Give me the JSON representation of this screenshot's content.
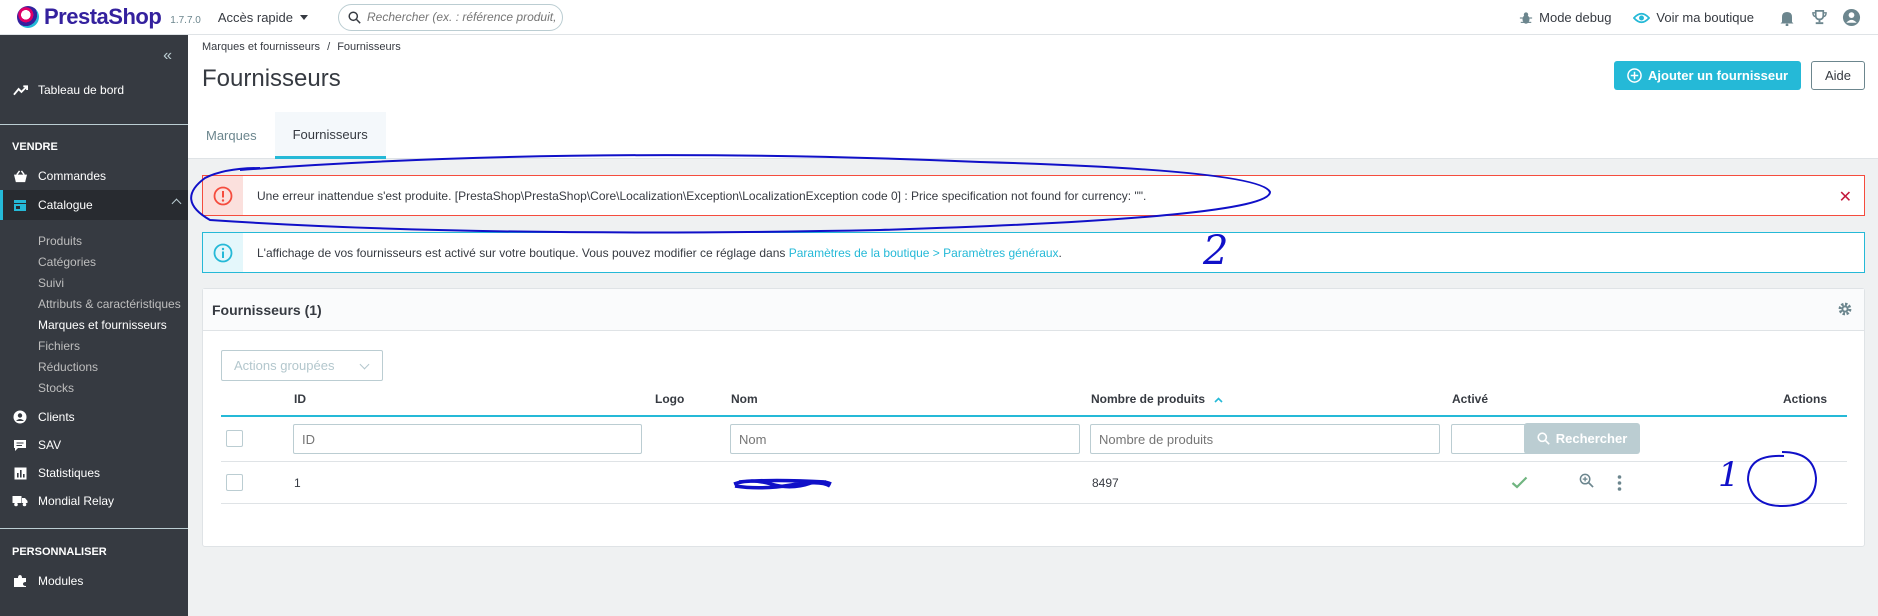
{
  "header": {
    "brand": "PrestaShop",
    "version": "1.7.7.0",
    "quick_access": "Accès rapide",
    "search_placeholder": "Rechercher (ex. : référence produit, nom",
    "debug_label": "Mode debug",
    "view_shop_label": "Voir ma boutique"
  },
  "sidebar": {
    "dashboard": "Tableau de bord",
    "section_sell": "VENDRE",
    "orders": "Commandes",
    "catalog": "Catalogue",
    "catalog_items": [
      "Produits",
      "Catégories",
      "Suivi",
      "Attributs & caractéristiques",
      "Marques et fournisseurs",
      "Fichiers",
      "Réductions",
      "Stocks"
    ],
    "customers": "Clients",
    "sav": "SAV",
    "stats": "Statistiques",
    "mondial": "Mondial Relay",
    "section_custom": "PERSONNALISER",
    "modules": "Modules"
  },
  "page": {
    "breadcrumb_parent": "Marques et fournisseurs",
    "breadcrumb_sep": "/",
    "breadcrumb_current": "Fournisseurs",
    "title": "Fournisseurs",
    "add_button": "Ajouter un fournisseur",
    "help_button": "Aide",
    "tabs": [
      "Marques",
      "Fournisseurs"
    ]
  },
  "alerts": {
    "error_text": "Une erreur inattendue s'est produite. [PrestaShop\\PrestaShop\\Core\\Localization\\Exception\\LocalizationException code 0] : Price specification not found for currency: \"\".",
    "info_text": "L'affichage de vos fournisseurs est activé sur votre boutique. Vous pouvez modifier ce réglage dans ",
    "info_link": "Paramètres de la boutique > Paramètres généraux",
    "info_end": "."
  },
  "panel": {
    "title": "Fournisseurs (1)",
    "bulk_actions": "Actions groupées",
    "columns": {
      "id": "ID",
      "logo": "Logo",
      "name": "Nom",
      "products": "Nombre de produits",
      "active": "Activé",
      "actions": "Actions"
    },
    "filters": {
      "id_placeholder": "ID",
      "name_placeholder": "Nom",
      "products_placeholder": "Nombre de produits",
      "search_button": "Rechercher"
    },
    "rows": [
      {
        "id": "1",
        "name": "",
        "products": "8497",
        "active": true
      }
    ]
  },
  "colors": {
    "accent": "#25b9d7",
    "sidebar": "#363a41",
    "danger": "#f54c3e",
    "annotation": "#1010c8"
  },
  "annotations": {
    "mark_1": "1",
    "mark_2": "2"
  }
}
